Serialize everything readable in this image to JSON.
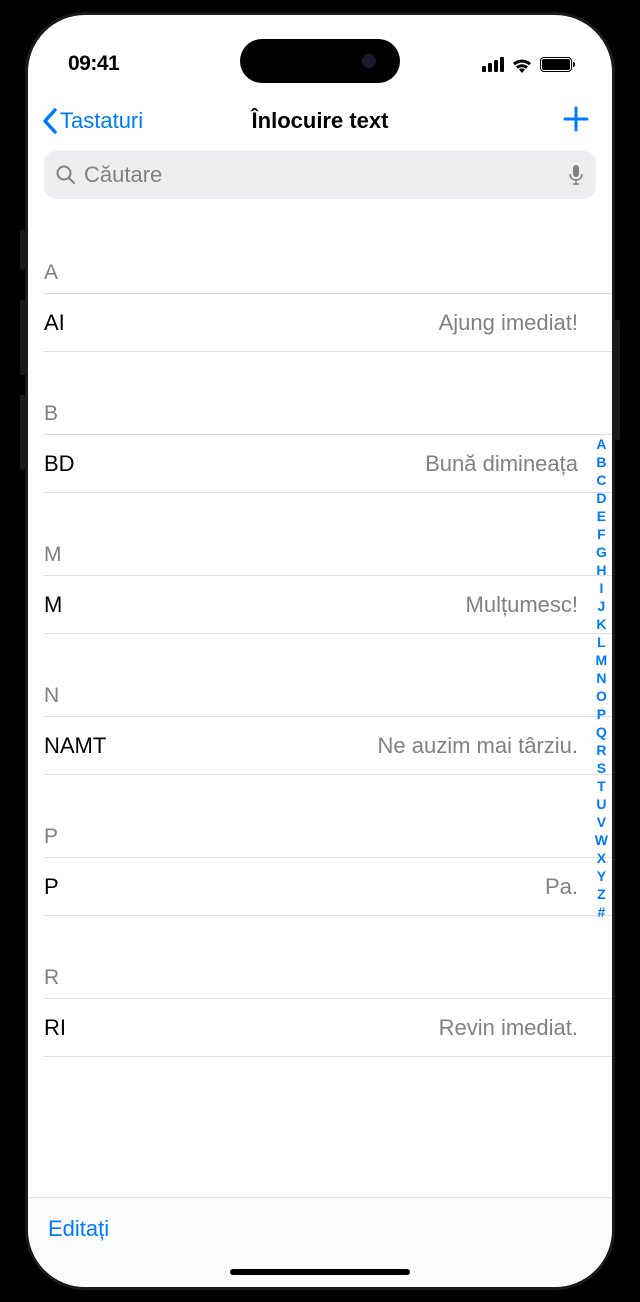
{
  "status_bar": {
    "time": "09:41"
  },
  "nav": {
    "back_label": "Tastaturi",
    "title": "Înlocuire text"
  },
  "search": {
    "placeholder": "Căutare"
  },
  "sections": [
    {
      "letter": "A",
      "items": [
        {
          "shortcut": "AI",
          "phrase": "Ajung imediat!"
        }
      ]
    },
    {
      "letter": "B",
      "items": [
        {
          "shortcut": "BD",
          "phrase": "Bună dimineața"
        }
      ]
    },
    {
      "letter": "M",
      "items": [
        {
          "shortcut": "M",
          "phrase": "Mulțumesc!"
        }
      ]
    },
    {
      "letter": "N",
      "items": [
        {
          "shortcut": "NAMT",
          "phrase": "Ne auzim mai târziu."
        }
      ]
    },
    {
      "letter": "P",
      "items": [
        {
          "shortcut": "P",
          "phrase": "Pa."
        }
      ]
    },
    {
      "letter": "R",
      "items": [
        {
          "shortcut": "RI",
          "phrase": "Revin imediat."
        }
      ]
    }
  ],
  "index_letters": [
    "A",
    "B",
    "C",
    "D",
    "E",
    "F",
    "G",
    "H",
    "I",
    "J",
    "K",
    "L",
    "M",
    "N",
    "O",
    "P",
    "Q",
    "R",
    "S",
    "T",
    "U",
    "V",
    "W",
    "X",
    "Y",
    "Z",
    "#"
  ],
  "bottom_bar": {
    "edit_label": "Editați"
  }
}
